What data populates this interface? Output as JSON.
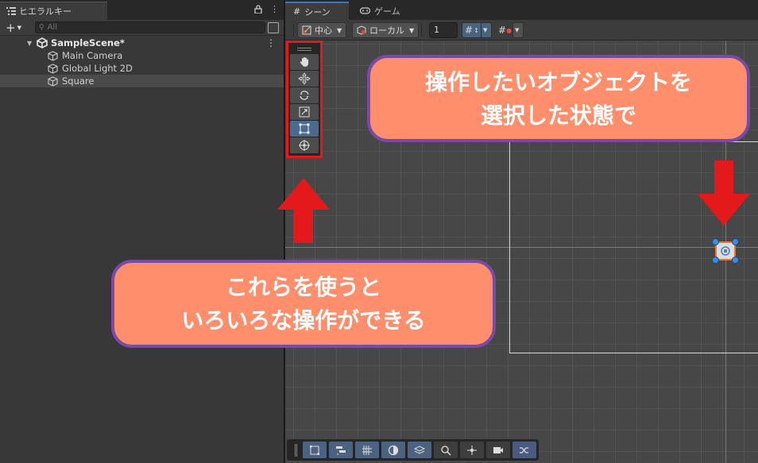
{
  "hierarchy": {
    "tab_label": "ヒエラルキー",
    "search_placeholder": "All",
    "scene_name": "SampleScene*",
    "items": [
      {
        "label": "Main Camera"
      },
      {
        "label": "Global Light 2D"
      },
      {
        "label": "Square"
      }
    ]
  },
  "scene": {
    "tabs": [
      {
        "label": "シーン"
      },
      {
        "label": "ゲーム"
      }
    ],
    "toolbar": {
      "pivot_label": "中心",
      "space_label": "ローカル",
      "grid_size": "1"
    }
  },
  "annotations": {
    "top_line1": "操作したいオブジェクトを",
    "top_line2": "選択した状態で",
    "bottom_line1": "これらを使うと",
    "bottom_line2": "いろいろな操作ができる"
  },
  "colors": {
    "highlight": "#e4191c",
    "callout_fill": "#ff8f6c",
    "callout_border": "#7a4aa8",
    "selection_orange": "#f07523",
    "active_tool_blue": "#4a6b8e"
  },
  "icons": {
    "tools": [
      "hand-icon",
      "move-icon",
      "rotate-icon",
      "scale-icon",
      "rect-icon",
      "transform-icon"
    ],
    "overlays": [
      "rect-overlay-icon",
      "align-icon",
      "grid-icon",
      "shading-icon",
      "layers-icon",
      "search-icon",
      "move-overlay-icon",
      "camera-icon",
      "shuffle-icon"
    ]
  }
}
